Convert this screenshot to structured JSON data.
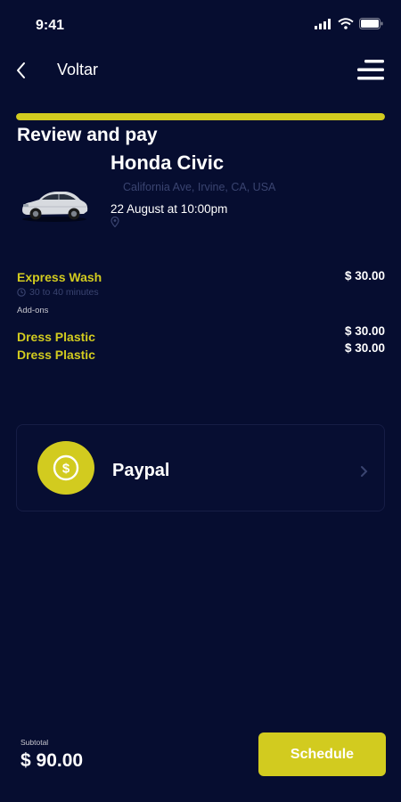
{
  "status_bar": {
    "time": "9:41"
  },
  "nav": {
    "title": "Voltar"
  },
  "progress": {
    "fraction": 1.0,
    "color": "#d2cb1f"
  },
  "page": {
    "title": "Review and pay"
  },
  "vehicle": {
    "name": "Honda Civic",
    "address": "California Ave, Irvine, CA, USA",
    "date": "22 August at 10:00pm"
  },
  "service": {
    "name": "Express Wash",
    "price": "$ 30.00",
    "duration": "30 to 40 minutes"
  },
  "addons": {
    "label": "Add-ons",
    "items": [
      {
        "name": "Dress Plastic",
        "price": "$ 30.00"
      },
      {
        "name": "Dress Plastic",
        "price": "$ 30.00"
      }
    ]
  },
  "payment": {
    "method": "Paypal",
    "icon": "dollar-coin-icon"
  },
  "footer": {
    "subtotal_label": "Subtotal",
    "subtotal_value": "$ 90.00",
    "schedule_label": "Schedule"
  },
  "colors": {
    "accent": "#d2cb1f",
    "background": "#060d30"
  }
}
